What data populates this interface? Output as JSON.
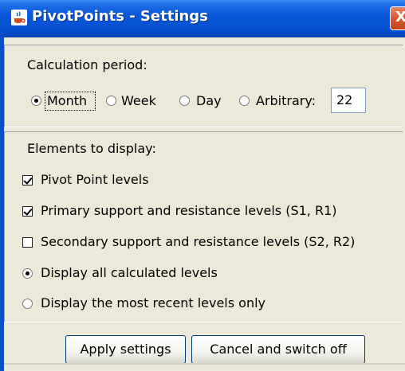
{
  "window": {
    "title": "PivotPoints - Settings",
    "close_icon_label": "X",
    "colors": {
      "titlebar": "#0a58da",
      "body": "#ece9d8",
      "close": "#d45a33"
    }
  },
  "calculation": {
    "heading": "Calculation period:",
    "options": [
      {
        "label": "Month",
        "selected": true
      },
      {
        "label": "Week",
        "selected": false
      },
      {
        "label": "Day",
        "selected": false
      },
      {
        "label": "Arbitrary:",
        "selected": false
      }
    ],
    "arbitrary_value": "22"
  },
  "elements": {
    "heading": "Elements to display:",
    "checkboxes": [
      {
        "label": "Pivot Point levels",
        "checked": true
      },
      {
        "label": "Primary support and resistance levels (S1, R1)",
        "checked": true
      },
      {
        "label": "Secondary support and resistance levels (S2, R2)",
        "checked": false
      }
    ],
    "display_modes": [
      {
        "label": "Display all calculated levels",
        "selected": true
      },
      {
        "label": "Display the most recent levels only",
        "selected": false
      }
    ]
  },
  "buttons": {
    "apply": "Apply settings",
    "cancel": "Cancel and switch off"
  }
}
